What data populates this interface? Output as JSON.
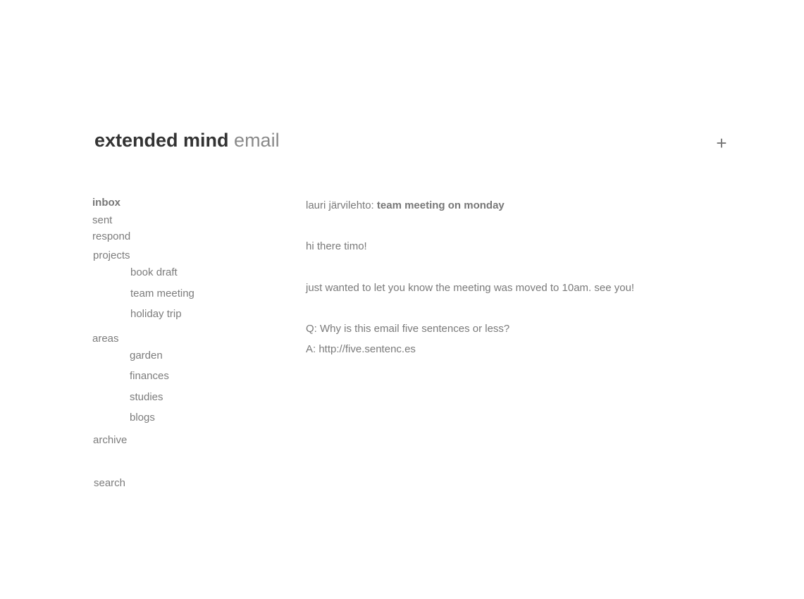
{
  "header": {
    "brand": "extended mind",
    "section": "email",
    "add_label": "+"
  },
  "sidebar": {
    "inbox": "inbox",
    "sent": "sent",
    "respond": "respond",
    "projects": {
      "label": "projects",
      "items": [
        "book draft",
        "team meeting",
        "holiday trip"
      ]
    },
    "areas": {
      "label": "areas",
      "items": [
        "garden",
        "finances",
        "studies",
        "blogs"
      ]
    },
    "archive": "archive",
    "search": "search"
  },
  "message": {
    "sender": "lauri järvilehto:",
    "subject": "team meeting on monday",
    "greeting": "hi there timo!",
    "body": "just wanted to let you know the meeting was moved to 10am. see you!",
    "footer_q": "Q: Why is this email five sentences or less?",
    "footer_a": "A: http://five.sentenc.es"
  }
}
